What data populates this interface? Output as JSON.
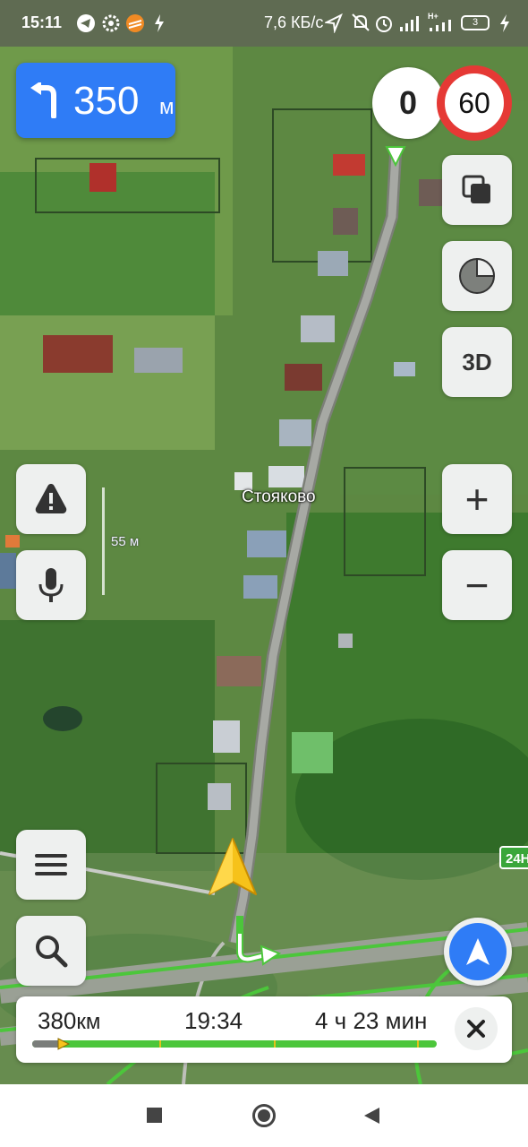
{
  "status_bar": {
    "time": "15:11",
    "net_speed": "7,6 КБ/с",
    "network_type": "H+",
    "battery": "3"
  },
  "maneuver": {
    "distance": "350",
    "unit": "м",
    "icon": "turn-left-arrow-icon"
  },
  "speed": {
    "current": "0",
    "limit": "60"
  },
  "map": {
    "place_label": "Стояково",
    "scale_label": "55 м",
    "road_badge": "24Н"
  },
  "controls": {
    "three_d_label": "3D",
    "zoom_in": "+",
    "zoom_out": "−"
  },
  "trip": {
    "distance_value": "380",
    "distance_unit": "км",
    "arrival_time": "19:34",
    "duration": "4 ч 23 мин",
    "progress": 0.07
  },
  "colors": {
    "accent_blue": "#2f7cf6",
    "route_green": "#4cc63b",
    "speed_limit_red": "#e53935"
  }
}
